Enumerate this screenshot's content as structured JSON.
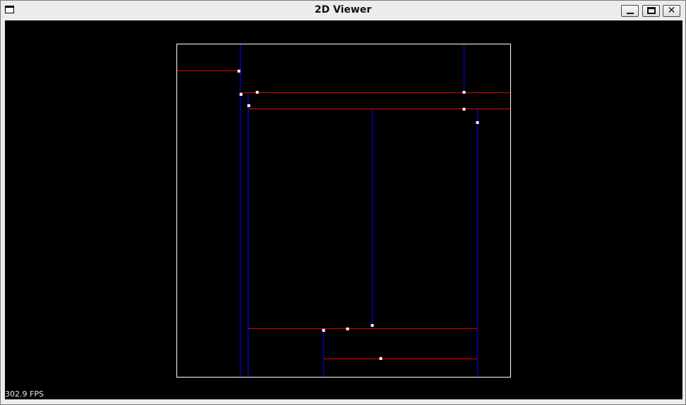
{
  "window": {
    "title": "2D Viewer",
    "buttons": {
      "minimize_icon": "minimize-icon",
      "maximize_icon": "maximize-icon",
      "close_symbol": "✕"
    }
  },
  "status": {
    "fps_text": "302.9 FPS"
  },
  "colors": {
    "background": "#000000",
    "border": "#ffffff",
    "red_line": "#cc0000",
    "blue_line": "#0000dd",
    "point": "#ffffff"
  }
}
